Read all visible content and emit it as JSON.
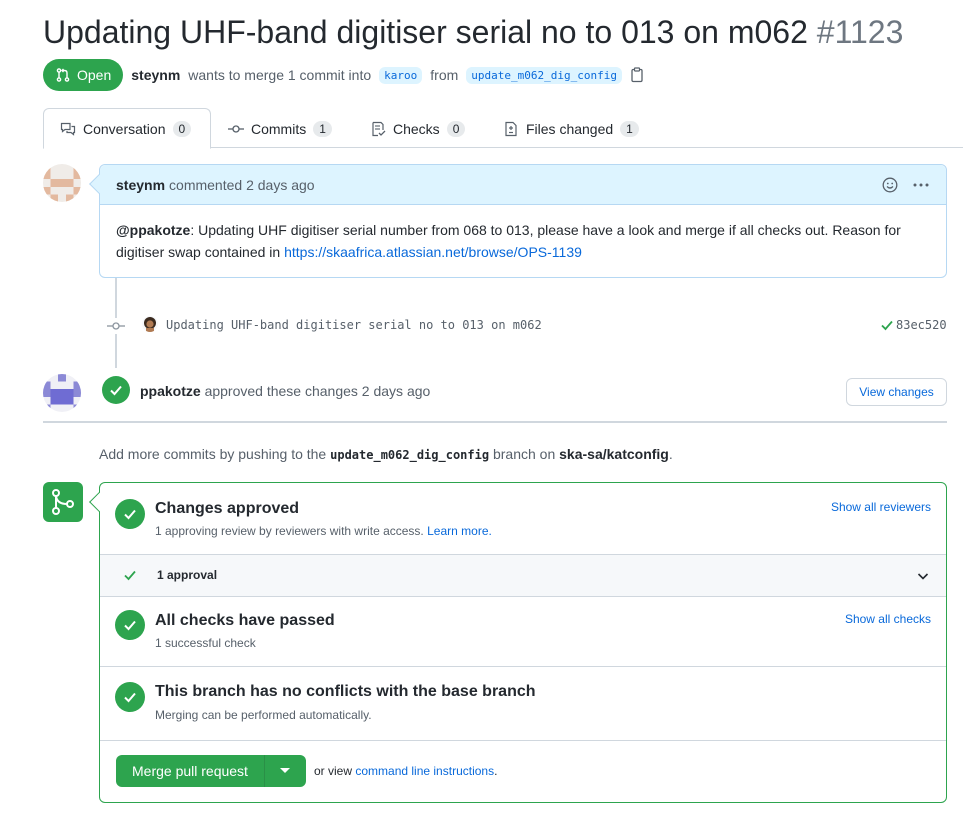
{
  "pr": {
    "title": "Updating UHF-band digitiser serial no to 013 on m062",
    "number": "#1123",
    "state": "Open",
    "author": "steynm",
    "merge_text_1": "wants to merge 1 commit into",
    "base_branch": "karoo",
    "from_text": "from",
    "head_branch": "update_m062_dig_config"
  },
  "tabs": [
    {
      "label": "Conversation",
      "count": "0",
      "icon": "comment-discussion-icon"
    },
    {
      "label": "Commits",
      "count": "1",
      "icon": "git-commit-icon"
    },
    {
      "label": "Checks",
      "count": "0",
      "icon": "checklist-icon"
    },
    {
      "label": "Files changed",
      "count": "1",
      "icon": "file-diff-icon"
    }
  ],
  "comment": {
    "author": "steynm",
    "meta": "commented 2 days ago",
    "mention": "@ppakotze",
    "body": ": Updating UHF digitiser serial number from 068 to 013, please have a look and merge if all checks out. Reason for digitiser swap contained in ",
    "link": "https://skaafrica.atlassian.net/browse/OPS-1139"
  },
  "commit": {
    "message": "Updating UHF-band digitiser serial no to 013 on m062",
    "sha": "83ec520"
  },
  "review": {
    "author": "ppakotze",
    "text": "approved these changes 2 days ago",
    "button": "View changes"
  },
  "push_hint": {
    "prefix": "Add more commits by pushing to the",
    "branch": "update_m062_dig_config",
    "middle": "branch on",
    "repo": "ska-sa/katconfig",
    "suffix": "."
  },
  "merge": {
    "approved_title": "Changes approved",
    "approved_sub": "1 approving review by reviewers with write access.",
    "learn_more": "Learn more.",
    "show_reviewers": "Show all reviewers",
    "approval_count": "1 approval",
    "checks_title": "All checks have passed",
    "checks_sub": "1 successful check",
    "show_checks": "Show all checks",
    "conflicts_title": "This branch has no conflicts with the base branch",
    "conflicts_sub": "Merging can be performed automatically.",
    "merge_button": "Merge pull request",
    "or_view": "or view",
    "cli_link": "command line instructions",
    "cli_suffix": "."
  },
  "colors": {
    "green": "#2da44e",
    "blue": "#0969da",
    "border": "#d0d7de"
  }
}
